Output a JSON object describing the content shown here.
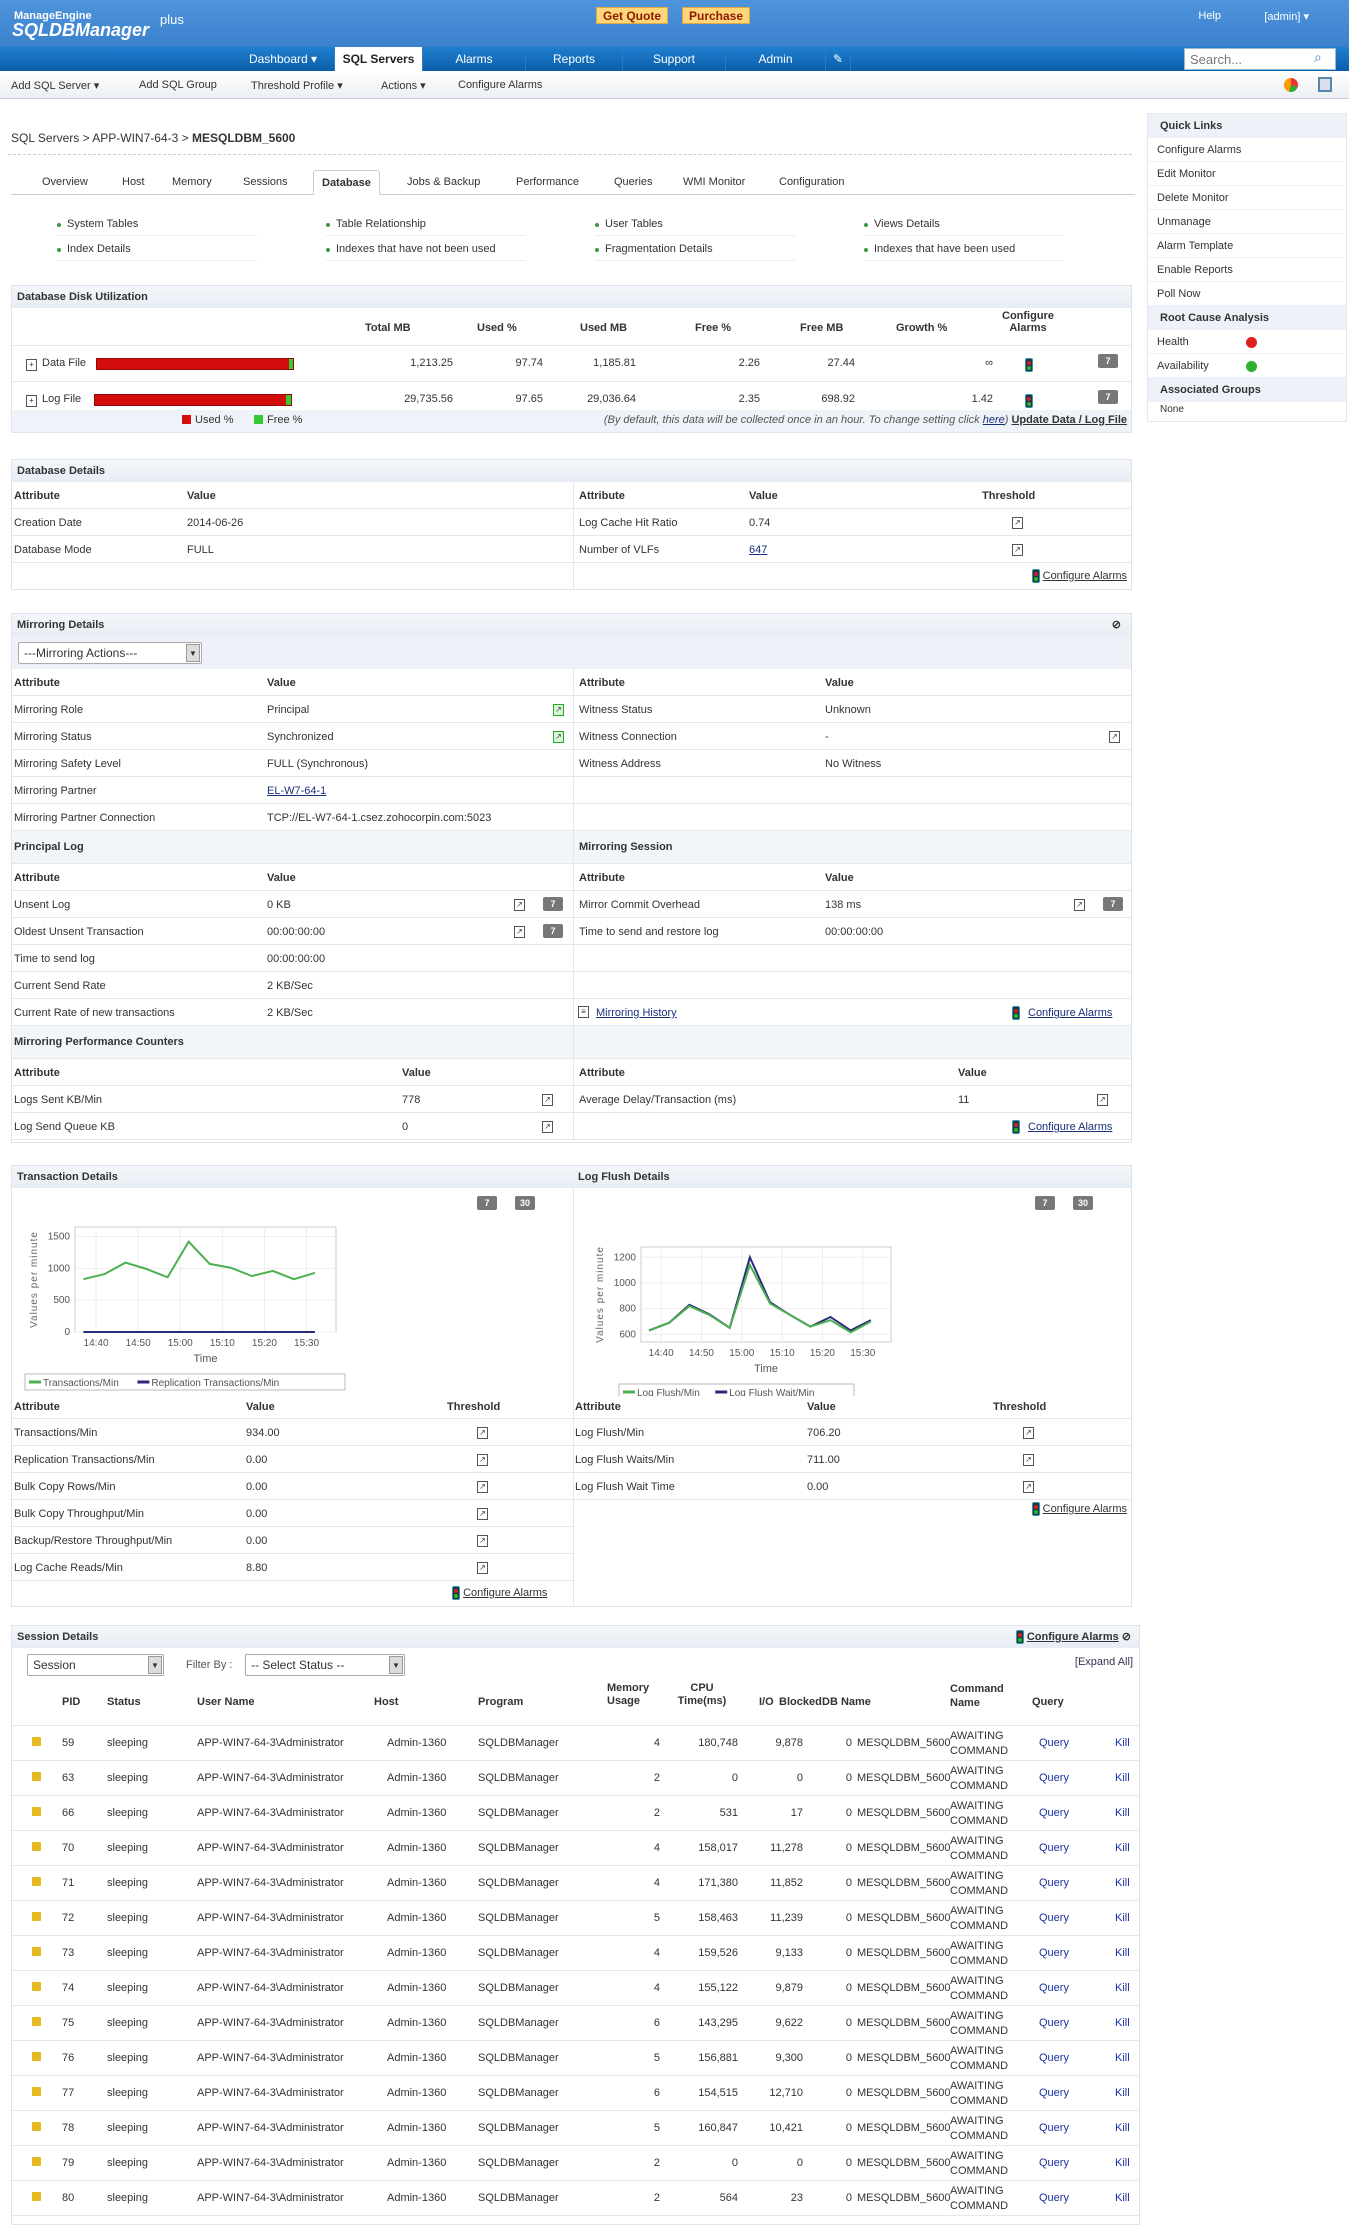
{
  "header": {
    "logo_top": "ManageEngine",
    "logo_main": "SQLDBManager",
    "logo_plus": "plus",
    "get_quote": "Get Quote",
    "purchase": "Purchase",
    "help": "Help",
    "user": "[admin] ▾"
  },
  "nav": {
    "items": [
      "Dashboard",
      "SQL Servers",
      "Alarms",
      "Reports",
      "Support",
      "Admin"
    ],
    "search_placeholder": "Search..."
  },
  "toolbar": {
    "items": [
      "Add SQL Server ▾",
      "Add SQL Group",
      "Threshold Profile ▾",
      "Actions ▾",
      "Configure Alarms"
    ]
  },
  "breadcrumb": {
    "part1": "SQL Servers",
    "sep": " > ",
    "part2": "APP-WIN7-64-3",
    "current": "MESQLDBM_5600"
  },
  "tabs": [
    "Overview",
    "Host",
    "Memory",
    "Sessions",
    "Database",
    "Jobs & Backup",
    "Performance",
    "Queries",
    "WMI Monitor",
    "Configuration"
  ],
  "quick_tables": [
    "System Tables",
    "Table Relationship",
    "User Tables",
    "Views Details",
    "Index Details",
    "Indexes that have not been used",
    "Fragmentation Details",
    "Indexes that have been used"
  ],
  "disk": {
    "title": "Database Disk Utilization",
    "cols": [
      "Total MB",
      "Used %",
      "Used MB",
      "Free %",
      "Free MB",
      "Growth %",
      "Configure Alarms"
    ],
    "rows": [
      {
        "name": "Data File",
        "used_pct": 97.74,
        "total": "1,213.25",
        "used": "97.74",
        "used_mb": "1,185.81",
        "free": "2.26",
        "free_mb": "27.44",
        "growth": "∞"
      },
      {
        "name": "Log File",
        "used_pct": 97.65,
        "total": "29,735.56",
        "used": "97.65",
        "used_mb": "29,036.64",
        "free": "2.35",
        "free_mb": "698.92",
        "growth": "1.42"
      }
    ],
    "legend_used": "Used %",
    "legend_free": "Free %",
    "note": "(By default, this data will be collected once in an hour. To change setting click ",
    "note_link": "here",
    "note_end": ")",
    "update": "Update Data / Log File",
    "btn7": "7"
  },
  "dbdetails": {
    "title": "Database Details",
    "h_attr": "Attribute",
    "h_val": "Value",
    "h_thr": "Threshold",
    "left": [
      [
        "Creation Date",
        "2014-06-26"
      ],
      [
        "Database Mode",
        "FULL"
      ]
    ],
    "right": [
      [
        "Log Cache Hit Ratio",
        "0.74"
      ],
      [
        "Number of VLFs",
        "647"
      ]
    ],
    "configure": "Configure Alarms"
  },
  "mirroring": {
    "title": "Mirroring Details",
    "actions": "---Mirroring Actions---",
    "left": [
      [
        "Mirroring Role",
        "Principal"
      ],
      [
        "Mirroring Status",
        "Synchronized"
      ],
      [
        "Mirroring Safety Level",
        "FULL (Synchronous)"
      ],
      [
        "Mirroring Partner",
        "EL-W7-64-1"
      ],
      [
        "Mirroring Partner Connection",
        "TCP://EL-W7-64-1.csez.zohocorpin.com:5023"
      ]
    ],
    "right": [
      [
        "Witness Status",
        "Unknown"
      ],
      [
        "Witness Connection",
        "-"
      ],
      [
        "Witness Address",
        "No Witness"
      ]
    ],
    "principal_log": "Principal Log",
    "mirroring_session": "Mirroring Session",
    "plog": [
      [
        "Unsent Log",
        "0 KB"
      ],
      [
        "Oldest Unsent Transaction",
        "00:00:00:00"
      ],
      [
        "Time to send log",
        "00:00:00:00"
      ],
      [
        "Current Send Rate",
        "2 KB/Sec"
      ],
      [
        "Current Rate of new transactions",
        "2 KB/Sec"
      ]
    ],
    "msess": [
      [
        "Mirror Commit Overhead",
        "138 ms"
      ],
      [
        "Time to send and restore log",
        "00:00:00:00"
      ]
    ],
    "history": "Mirroring History",
    "configure": "Configure Alarms",
    "perf_title": "Mirroring Performance Counters",
    "perf_left": [
      [
        "Logs Sent KB/Min",
        "778"
      ],
      [
        "Log Send Queue KB",
        "0"
      ]
    ],
    "perf_right": [
      [
        "Average Delay/Transaction (ms)",
        "11"
      ]
    ]
  },
  "transaction": {
    "title": "Transaction Details",
    "btn7": "7",
    "btn30": "30",
    "rows": [
      [
        "Transactions/Min",
        "934.00"
      ],
      [
        "Replication Transactions/Min",
        "0.00"
      ],
      [
        "Bulk Copy Rows/Min",
        "0.00"
      ],
      [
        "Bulk Copy Throughput/Min",
        "0.00"
      ],
      [
        "Backup/Restore Throughput/Min",
        "0.00"
      ],
      [
        "Log Cache Reads/Min",
        "8.80"
      ]
    ],
    "configure": "Configure Alarms"
  },
  "logflush": {
    "title": "Log Flush Details",
    "rows": [
      [
        "Log Flush/Min",
        "706.20"
      ],
      [
        "Log Flush Waits/Min",
        "711.00"
      ],
      [
        "Log Flush Wait Time",
        "0.00"
      ]
    ],
    "configure": "Configure Alarms"
  },
  "chart_data": [
    {
      "type": "line",
      "ylabel": "Values per minute",
      "xlabel": "Time",
      "ylim": [
        0,
        1650
      ],
      "yticks": [
        0,
        500,
        1000,
        1500
      ],
      "xticks": [
        "14:40",
        "14:50",
        "15:00",
        "15:10",
        "15:20",
        "15:30"
      ],
      "x": [
        "14:37",
        "14:42",
        "14:47",
        "14:52",
        "14:57",
        "15:02",
        "15:07",
        "15:12",
        "15:17",
        "15:22",
        "15:27",
        "15:32"
      ],
      "series": [
        {
          "name": "Transactions/Min",
          "color": "#4caf50",
          "values": [
            830,
            910,
            1090,
            990,
            860,
            1420,
            1070,
            1010,
            880,
            960,
            830,
            930
          ]
        },
        {
          "name": "Replication Transactions/Min",
          "color": "#2a2a7a",
          "values": [
            0,
            0,
            0,
            0,
            0,
            0,
            0,
            0,
            0,
            0,
            0,
            0
          ]
        }
      ]
    },
    {
      "type": "line",
      "ylabel": "Values per minute",
      "xlabel": "Time",
      "ylim": [
        540,
        1280
      ],
      "yticks": [
        600,
        800,
        1000,
        1200
      ],
      "xticks": [
        "14:40",
        "14:50",
        "15:00",
        "15:10",
        "15:20",
        "15:30"
      ],
      "x": [
        "14:37",
        "14:42",
        "14:47",
        "14:52",
        "14:57",
        "15:02",
        "15:07",
        "15:12",
        "15:17",
        "15:22",
        "15:27",
        "15:32"
      ],
      "series": [
        {
          "name": "Log Flush/Min",
          "color": "#4caf50",
          "values": [
            630,
            690,
            820,
            750,
            650,
            1140,
            840,
            750,
            660,
            710,
            615,
            700
          ]
        },
        {
          "name": "Log Flush Wait/Min",
          "color": "#2a2a7a",
          "values": [
            630,
            690,
            830,
            755,
            650,
            1200,
            850,
            750,
            660,
            735,
            630,
            710
          ]
        }
      ]
    }
  ],
  "sessions": {
    "title": "Session Details",
    "configure": "Configure Alarms",
    "view": "Session",
    "filter_label": "Filter By :",
    "filter": "-- Select Status --",
    "expand": "[Expand All]",
    "cols": [
      "PID",
      "Status",
      "User Name",
      "Host",
      "Program",
      "Memory Usage",
      "CPU Time(ms)",
      "I/O",
      "Blocked",
      "DB Name",
      "Command Name",
      "Query"
    ],
    "rows": [
      [
        "59",
        "sleeping",
        "APP-WIN7-64-3\\Administrator",
        "Admin-1360",
        "SQLDBManager",
        "4",
        "180,748",
        "9,878",
        "0",
        "MESQLDBM_5600",
        "AWAITING COMMAND"
      ],
      [
        "63",
        "sleeping",
        "APP-WIN7-64-3\\Administrator",
        "Admin-1360",
        "SQLDBManager",
        "2",
        "0",
        "0",
        "0",
        "MESQLDBM_5600",
        "AWAITING COMMAND"
      ],
      [
        "66",
        "sleeping",
        "APP-WIN7-64-3\\Administrator",
        "Admin-1360",
        "SQLDBManager",
        "2",
        "531",
        "17",
        "0",
        "MESQLDBM_5600",
        "AWAITING COMMAND"
      ],
      [
        "70",
        "sleeping",
        "APP-WIN7-64-3\\Administrator",
        "Admin-1360",
        "SQLDBManager",
        "4",
        "158,017",
        "11,278",
        "0",
        "MESQLDBM_5600",
        "AWAITING COMMAND"
      ],
      [
        "71",
        "sleeping",
        "APP-WIN7-64-3\\Administrator",
        "Admin-1360",
        "SQLDBManager",
        "4",
        "171,380",
        "11,852",
        "0",
        "MESQLDBM_5600",
        "AWAITING COMMAND"
      ],
      [
        "72",
        "sleeping",
        "APP-WIN7-64-3\\Administrator",
        "Admin-1360",
        "SQLDBManager",
        "5",
        "158,463",
        "11,239",
        "0",
        "MESQLDBM_5600",
        "AWAITING COMMAND"
      ],
      [
        "73",
        "sleeping",
        "APP-WIN7-64-3\\Administrator",
        "Admin-1360",
        "SQLDBManager",
        "4",
        "159,526",
        "9,133",
        "0",
        "MESQLDBM_5600",
        "AWAITING COMMAND"
      ],
      [
        "74",
        "sleeping",
        "APP-WIN7-64-3\\Administrator",
        "Admin-1360",
        "SQLDBManager",
        "4",
        "155,122",
        "9,879",
        "0",
        "MESQLDBM_5600",
        "AWAITING COMMAND"
      ],
      [
        "75",
        "sleeping",
        "APP-WIN7-64-3\\Administrator",
        "Admin-1360",
        "SQLDBManager",
        "6",
        "143,295",
        "9,622",
        "0",
        "MESQLDBM_5600",
        "AWAITING COMMAND"
      ],
      [
        "76",
        "sleeping",
        "APP-WIN7-64-3\\Administrator",
        "Admin-1360",
        "SQLDBManager",
        "5",
        "156,881",
        "9,300",
        "0",
        "MESQLDBM_5600",
        "AWAITING COMMAND"
      ],
      [
        "77",
        "sleeping",
        "APP-WIN7-64-3\\Administrator",
        "Admin-1360",
        "SQLDBManager",
        "6",
        "154,515",
        "12,710",
        "0",
        "MESQLDBM_5600",
        "AWAITING COMMAND"
      ],
      [
        "78",
        "sleeping",
        "APP-WIN7-64-3\\Administrator",
        "Admin-1360",
        "SQLDBManager",
        "5",
        "160,847",
        "10,421",
        "0",
        "MESQLDBM_5600",
        "AWAITING COMMAND"
      ],
      [
        "79",
        "sleeping",
        "APP-WIN7-64-3\\Administrator",
        "Admin-1360",
        "SQLDBManager",
        "2",
        "0",
        "0",
        "0",
        "MESQLDBM_5600",
        "AWAITING COMMAND"
      ],
      [
        "80",
        "sleeping",
        "APP-WIN7-64-3\\Administrator",
        "Admin-1360",
        "SQLDBManager",
        "2",
        "564",
        "23",
        "0",
        "MESQLDBM_5600",
        "AWAITING COMMAND"
      ]
    ],
    "query_link": "Query",
    "kill_link": "Kill"
  },
  "sidebar": {
    "quick_links": "Quick Links",
    "items": [
      "Configure Alarms",
      "Edit Monitor",
      "Delete Monitor",
      "Unmanage",
      "Alarm Template",
      "Enable Reports",
      "Poll Now"
    ],
    "rca": "Root Cause Analysis",
    "health": "Health",
    "availability": "Availability",
    "health_color": "#e02020",
    "availability_color": "#30b030",
    "groups": "Associated Groups",
    "groups_value": "None"
  }
}
